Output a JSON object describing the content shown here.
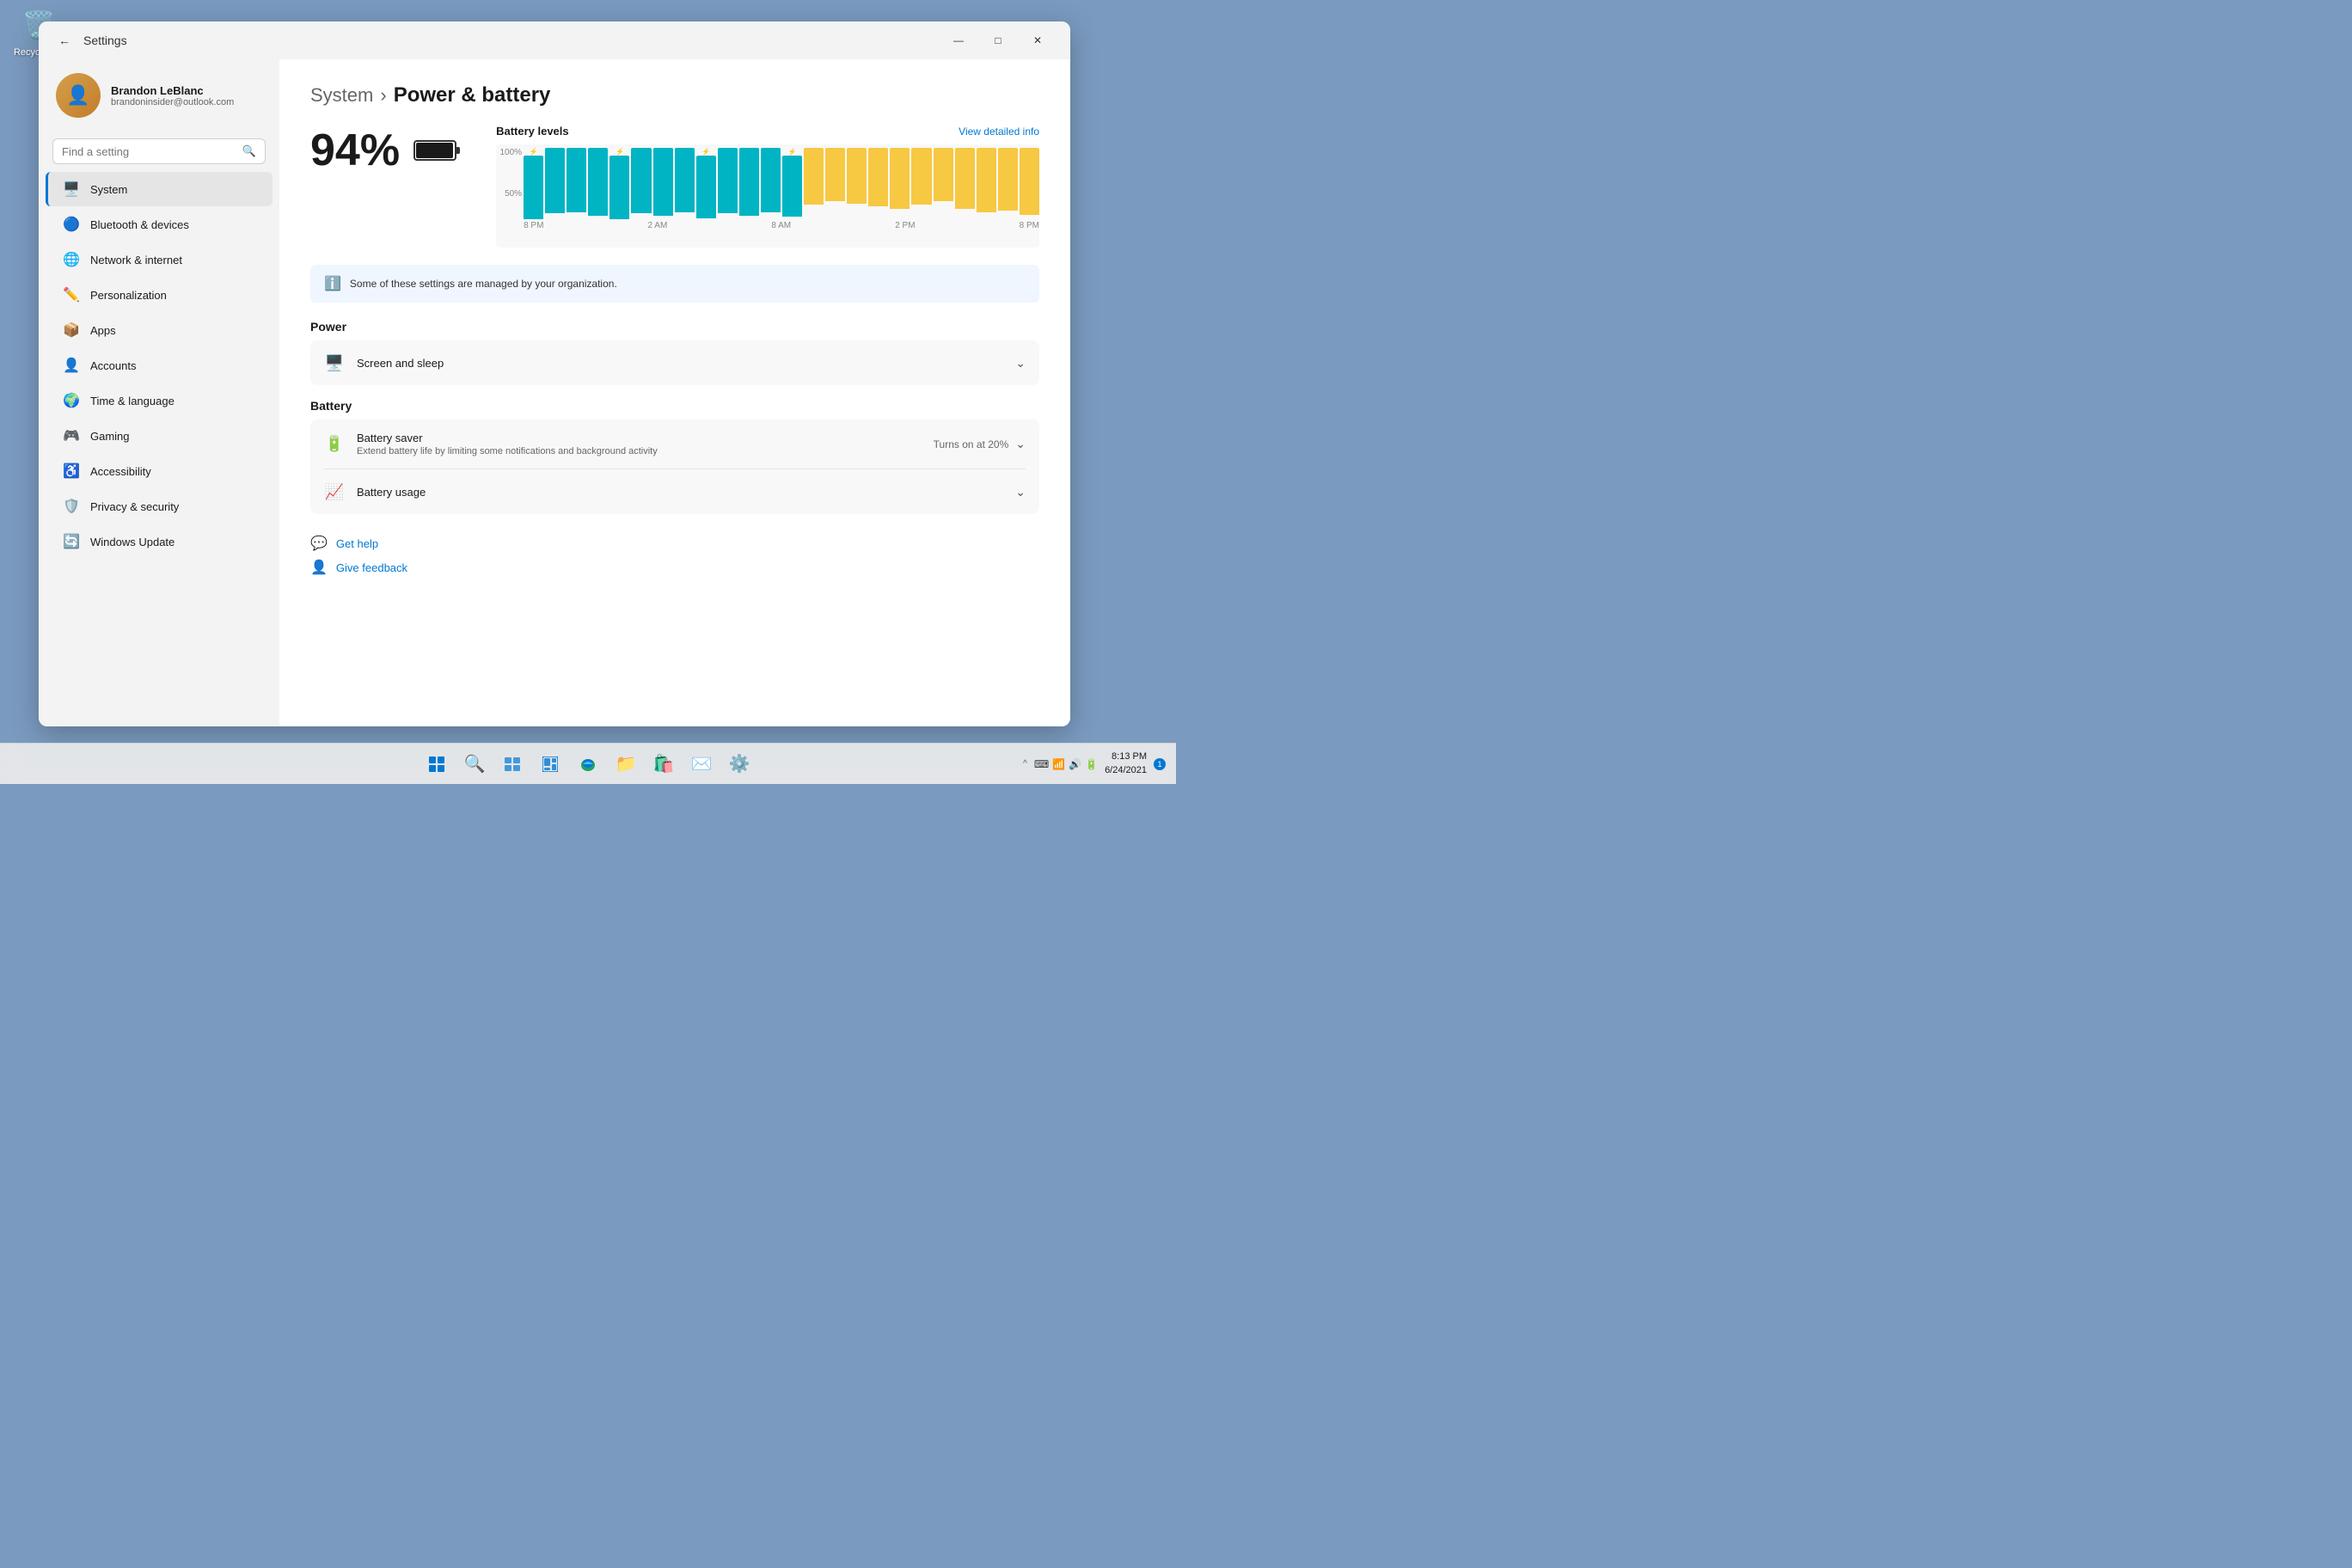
{
  "desktop": {
    "recycle_bin_label": "Recycle Bin"
  },
  "window": {
    "title": "Settings",
    "back_button_label": "←",
    "minimize_label": "—",
    "maximize_label": "□",
    "close_label": "✕"
  },
  "user": {
    "name": "Brandon LeBlanc",
    "email": "brandoninsider@outlook.com"
  },
  "search": {
    "placeholder": "Find a setting"
  },
  "nav": {
    "items": [
      {
        "id": "system",
        "label": "System",
        "icon": "🖥️",
        "active": true
      },
      {
        "id": "bluetooth",
        "label": "Bluetooth & devices",
        "icon": "🔵",
        "active": false
      },
      {
        "id": "network",
        "label": "Network & internet",
        "icon": "🌐",
        "active": false
      },
      {
        "id": "personalization",
        "label": "Personalization",
        "icon": "✏️",
        "active": false
      },
      {
        "id": "apps",
        "label": "Apps",
        "icon": "📦",
        "active": false
      },
      {
        "id": "accounts",
        "label": "Accounts",
        "icon": "👤",
        "active": false
      },
      {
        "id": "time",
        "label": "Time & language",
        "icon": "🌍",
        "active": false
      },
      {
        "id": "gaming",
        "label": "Gaming",
        "icon": "🎮",
        "active": false
      },
      {
        "id": "accessibility",
        "label": "Accessibility",
        "icon": "♿",
        "active": false
      },
      {
        "id": "privacy",
        "label": "Privacy & security",
        "icon": "🛡️",
        "active": false
      },
      {
        "id": "update",
        "label": "Windows Update",
        "icon": "🔄",
        "active": false
      }
    ]
  },
  "content": {
    "breadcrumb_parent": "System",
    "breadcrumb_current": "Power & battery",
    "battery_percentage": "94%",
    "chart": {
      "title": "Battery levels",
      "view_detailed": "View detailed info",
      "y_labels": [
        "100%",
        "50%"
      ],
      "x_labels": [
        "8 PM",
        "2 AM",
        "8 AM",
        "2 PM",
        "8 PM"
      ],
      "bars": [
        {
          "height": 95,
          "type": "charging"
        },
        {
          "height": 92,
          "type": "charging"
        },
        {
          "height": 90,
          "type": "charging"
        },
        {
          "height": 95,
          "type": "charging"
        },
        {
          "height": 93,
          "type": "charging"
        },
        {
          "height": 91,
          "type": "charging"
        },
        {
          "height": 95,
          "type": "charging"
        },
        {
          "height": 90,
          "type": "charging"
        },
        {
          "height": 88,
          "type": "charging"
        },
        {
          "height": 92,
          "type": "charging"
        },
        {
          "height": 95,
          "type": "charging"
        },
        {
          "height": 90,
          "type": "charging"
        },
        {
          "height": 85,
          "type": "charging"
        },
        {
          "height": 80,
          "type": "draining"
        },
        {
          "height": 75,
          "type": "draining"
        },
        {
          "height": 78,
          "type": "draining"
        },
        {
          "height": 82,
          "type": "draining"
        },
        {
          "height": 85,
          "type": "draining"
        },
        {
          "height": 80,
          "type": "draining"
        },
        {
          "height": 75,
          "type": "draining"
        },
        {
          "height": 85,
          "type": "draining"
        },
        {
          "height": 90,
          "type": "draining"
        },
        {
          "height": 88,
          "type": "draining"
        },
        {
          "height": 94,
          "type": "draining"
        }
      ]
    },
    "info_banner": "Some of these settings are managed by your organization.",
    "power_section_title": "Power",
    "screen_sleep_label": "Screen and sleep",
    "battery_section_title": "Battery",
    "battery_saver_label": "Battery saver",
    "battery_saver_subtitle": "Extend battery life by limiting some notifications and background activity",
    "battery_saver_status": "Turns on at 20%",
    "battery_usage_label": "Battery usage",
    "get_help_label": "Get help",
    "give_feedback_label": "Give feedback"
  },
  "taskbar": {
    "items": [
      {
        "id": "start",
        "type": "windows"
      },
      {
        "id": "search",
        "icon": "🔍"
      },
      {
        "id": "task-view",
        "icon": "🗂️"
      },
      {
        "id": "widgets",
        "icon": "⊞"
      },
      {
        "id": "edge",
        "icon": "🌐"
      },
      {
        "id": "explorer",
        "icon": "📁"
      },
      {
        "id": "store",
        "icon": "🛍️"
      },
      {
        "id": "mail",
        "icon": "✉️"
      },
      {
        "id": "settings",
        "icon": "⚙️"
      }
    ],
    "show_hidden_label": "Show hidden icons",
    "clock_time": "8:13 PM",
    "clock_date": "6/24/2021",
    "notification_count": "1"
  }
}
